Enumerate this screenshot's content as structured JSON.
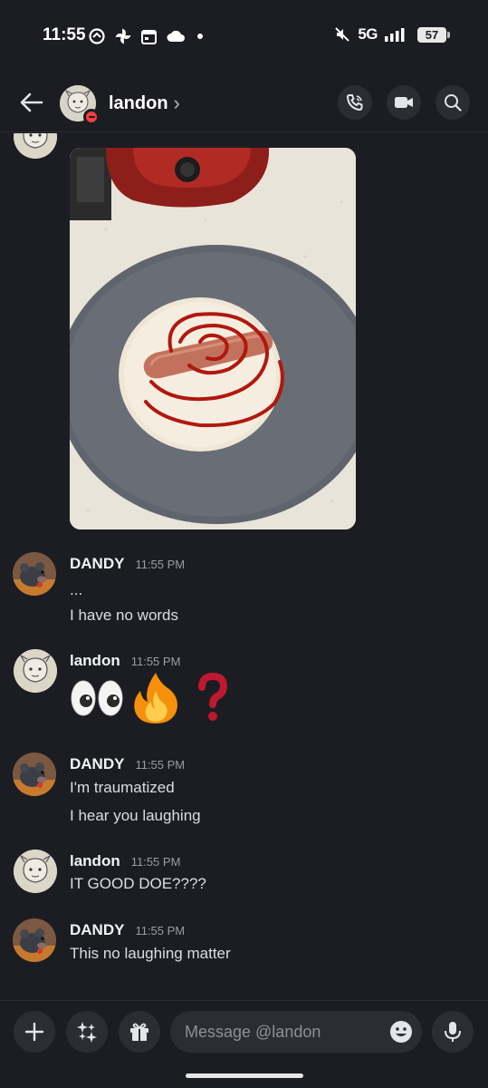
{
  "status_bar": {
    "time": "11:55",
    "network": "5G",
    "battery": "57"
  },
  "header": {
    "name": "landon",
    "chevron": "›"
  },
  "messages": [
    {
      "author": "DANDY",
      "time": "11:55 PM",
      "lines": [
        "...",
        "I have no words"
      ]
    },
    {
      "author": "landon",
      "time": "11:55 PM",
      "lines": []
    },
    {
      "author": "DANDY",
      "time": "11:55 PM",
      "lines": [
        "I'm traumatized",
        "I hear you laughing"
      ]
    },
    {
      "author": "landon",
      "time": "11:55 PM",
      "lines": [
        "IT GOOD DOE????"
      ]
    },
    {
      "author": "DANDY",
      "time": "11:55 PM",
      "lines": [
        "This no laughing matter"
      ]
    }
  ],
  "emojis": [
    "👀",
    "🔥",
    "❓"
  ],
  "composer": {
    "placeholder": "Message @landon"
  },
  "colors": {
    "background": "#1c1d22",
    "button_bg": "#2b2d33",
    "dnd_red": "#f23f43"
  }
}
